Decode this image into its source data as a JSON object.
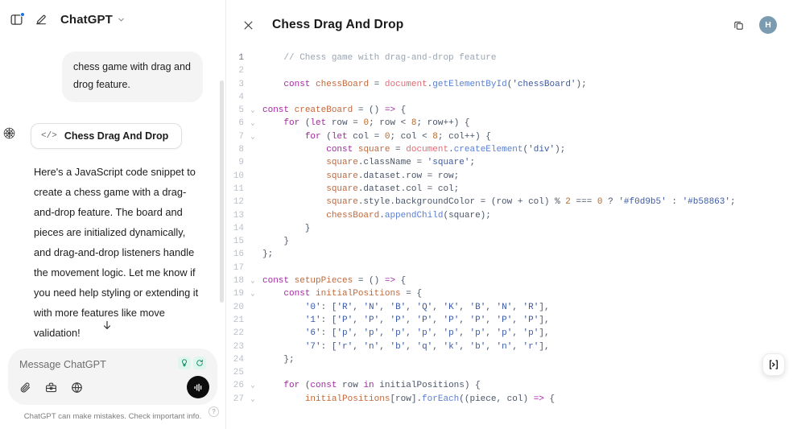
{
  "chat": {
    "topbar": {
      "sidebar_toggle_icon": "sidebar-toggle-icon",
      "new_chat_icon": "compose-icon",
      "brand": "ChatGPT",
      "brand_chevron_icon": "chevron-down-icon"
    },
    "user_message": "chess game with drag and drog feature.",
    "artifact_pill": {
      "icon": "code-brackets-icon",
      "label": "Chess Drag And Drop"
    },
    "assistant_message": "Here's a JavaScript code snippet to create a chess game with a drag-and-drop feature. The board and pieces are initialized dynamically, and drag-and-drop listeners handle the movement logic. Let me know if you need help styling or extending it with more features like move validation!",
    "actions": [
      {
        "name": "read-aloud-icon",
        "title": "Read aloud"
      },
      {
        "name": "copy-icon",
        "title": "Copy"
      },
      {
        "name": "thumbs-up-icon",
        "title": "Good response"
      },
      {
        "name": "thumbs-down-icon",
        "title": "Bad response"
      }
    ],
    "scroll_down_icon": "arrow-down-icon",
    "composer": {
      "placeholder": "Message ChatGPT",
      "value": "",
      "chips": [
        {
          "name": "lightbulb-icon"
        },
        {
          "name": "sync-icon"
        }
      ],
      "tools": [
        {
          "name": "attach-icon"
        },
        {
          "name": "toolbox-icon"
        },
        {
          "name": "globe-icon"
        }
      ],
      "voice_button_icon": "voice-waveform-icon"
    },
    "disclaimer": "ChatGPT can make mistakes. Check important info.",
    "help_label": "?"
  },
  "code_panel": {
    "close_icon": "close-icon",
    "title": "Chess Drag And Drop",
    "copy_icon": "copy-icon",
    "avatar_initial": "H",
    "run_button_icon": "run-code-icon",
    "lines": [
      {
        "n": "1",
        "fold": "",
        "tokens": [
          {
            "t": "    ",
            "c": "t-pl"
          },
          {
            "t": "// Chess game with drag-and-drop feature",
            "c": "t-com"
          }
        ]
      },
      {
        "n": "2",
        "fold": "",
        "tokens": []
      },
      {
        "n": "3",
        "fold": "",
        "tokens": [
          {
            "t": "    ",
            "c": "t-pl"
          },
          {
            "t": "const",
            "c": "t-kw"
          },
          {
            "t": " ",
            "c": "t-pl"
          },
          {
            "t": "chessBoard",
            "c": "t-var"
          },
          {
            "t": " = ",
            "c": "t-op"
          },
          {
            "t": "document",
            "c": "t-obj"
          },
          {
            "t": ".",
            "c": "t-op"
          },
          {
            "t": "getElementById",
            "c": "t-fn"
          },
          {
            "t": "(",
            "c": "t-op"
          },
          {
            "t": "'chessBoard'",
            "c": "t-str"
          },
          {
            "t": ");",
            "c": "t-op"
          }
        ]
      },
      {
        "n": "4",
        "fold": "",
        "tokens": []
      },
      {
        "n": "5",
        "fold": "v",
        "tokens": [
          {
            "t": "const",
            "c": "t-kw"
          },
          {
            "t": " ",
            "c": "t-pl"
          },
          {
            "t": "createBoard",
            "c": "t-var"
          },
          {
            "t": " = () ",
            "c": "t-op"
          },
          {
            "t": "=>",
            "c": "t-kw"
          },
          {
            "t": " {",
            "c": "t-op"
          }
        ]
      },
      {
        "n": "6",
        "fold": "v",
        "tokens": [
          {
            "t": "    ",
            "c": "t-pl"
          },
          {
            "t": "for",
            "c": "t-kw"
          },
          {
            "t": " (",
            "c": "t-op"
          },
          {
            "t": "let",
            "c": "t-kw"
          },
          {
            "t": " row = ",
            "c": "t-op"
          },
          {
            "t": "0",
            "c": "t-num"
          },
          {
            "t": "; row < ",
            "c": "t-op"
          },
          {
            "t": "8",
            "c": "t-num"
          },
          {
            "t": "; row++) {",
            "c": "t-op"
          }
        ]
      },
      {
        "n": "7",
        "fold": "v",
        "tokens": [
          {
            "t": "        ",
            "c": "t-pl"
          },
          {
            "t": "for",
            "c": "t-kw"
          },
          {
            "t": " (",
            "c": "t-op"
          },
          {
            "t": "let",
            "c": "t-kw"
          },
          {
            "t": " col = ",
            "c": "t-op"
          },
          {
            "t": "0",
            "c": "t-num"
          },
          {
            "t": "; col < ",
            "c": "t-op"
          },
          {
            "t": "8",
            "c": "t-num"
          },
          {
            "t": "; col++) {",
            "c": "t-op"
          }
        ]
      },
      {
        "n": "8",
        "fold": "",
        "tokens": [
          {
            "t": "            ",
            "c": "t-pl"
          },
          {
            "t": "const",
            "c": "t-kw"
          },
          {
            "t": " ",
            "c": "t-pl"
          },
          {
            "t": "square",
            "c": "t-var"
          },
          {
            "t": " = ",
            "c": "t-op"
          },
          {
            "t": "document",
            "c": "t-obj"
          },
          {
            "t": ".",
            "c": "t-op"
          },
          {
            "t": "createElement",
            "c": "t-fn"
          },
          {
            "t": "(",
            "c": "t-op"
          },
          {
            "t": "'div'",
            "c": "t-str"
          },
          {
            "t": ");",
            "c": "t-op"
          }
        ]
      },
      {
        "n": "9",
        "fold": "",
        "tokens": [
          {
            "t": "            ",
            "c": "t-pl"
          },
          {
            "t": "square",
            "c": "t-var"
          },
          {
            "t": ".className = ",
            "c": "t-op"
          },
          {
            "t": "'square'",
            "c": "t-str"
          },
          {
            "t": ";",
            "c": "t-op"
          }
        ]
      },
      {
        "n": "10",
        "fold": "",
        "tokens": [
          {
            "t": "            ",
            "c": "t-pl"
          },
          {
            "t": "square",
            "c": "t-var"
          },
          {
            "t": ".dataset.row = row;",
            "c": "t-op"
          }
        ]
      },
      {
        "n": "11",
        "fold": "",
        "tokens": [
          {
            "t": "            ",
            "c": "t-pl"
          },
          {
            "t": "square",
            "c": "t-var"
          },
          {
            "t": ".dataset.col = col;",
            "c": "t-op"
          }
        ]
      },
      {
        "n": "12",
        "fold": "",
        "tokens": [
          {
            "t": "            ",
            "c": "t-pl"
          },
          {
            "t": "square",
            "c": "t-var"
          },
          {
            "t": ".style.backgroundColor = (row + col) % ",
            "c": "t-op"
          },
          {
            "t": "2",
            "c": "t-num"
          },
          {
            "t": " === ",
            "c": "t-op"
          },
          {
            "t": "0",
            "c": "t-num"
          },
          {
            "t": " ? ",
            "c": "t-op"
          },
          {
            "t": "'#f0d9b5'",
            "c": "t-str"
          },
          {
            "t": " : ",
            "c": "t-op"
          },
          {
            "t": "'#b58863'",
            "c": "t-str"
          },
          {
            "t": ";",
            "c": "t-op"
          }
        ]
      },
      {
        "n": "13",
        "fold": "",
        "tokens": [
          {
            "t": "            ",
            "c": "t-pl"
          },
          {
            "t": "chessBoard",
            "c": "t-var"
          },
          {
            "t": ".",
            "c": "t-op"
          },
          {
            "t": "appendChild",
            "c": "t-fn"
          },
          {
            "t": "(square);",
            "c": "t-op"
          }
        ]
      },
      {
        "n": "14",
        "fold": "",
        "tokens": [
          {
            "t": "        }",
            "c": "t-op"
          }
        ]
      },
      {
        "n": "15",
        "fold": "",
        "tokens": [
          {
            "t": "    }",
            "c": "t-op"
          }
        ]
      },
      {
        "n": "16",
        "fold": "",
        "tokens": [
          {
            "t": "};",
            "c": "t-op"
          }
        ]
      },
      {
        "n": "17",
        "fold": "",
        "tokens": []
      },
      {
        "n": "18",
        "fold": "v",
        "tokens": [
          {
            "t": "const",
            "c": "t-kw"
          },
          {
            "t": " ",
            "c": "t-pl"
          },
          {
            "t": "setupPieces",
            "c": "t-var"
          },
          {
            "t": " = () ",
            "c": "t-op"
          },
          {
            "t": "=>",
            "c": "t-kw"
          },
          {
            "t": " {",
            "c": "t-op"
          }
        ]
      },
      {
        "n": "19",
        "fold": "v",
        "tokens": [
          {
            "t": "    ",
            "c": "t-pl"
          },
          {
            "t": "const",
            "c": "t-kw"
          },
          {
            "t": " ",
            "c": "t-pl"
          },
          {
            "t": "initialPositions",
            "c": "t-var"
          },
          {
            "t": " = {",
            "c": "t-op"
          }
        ]
      },
      {
        "n": "20",
        "fold": "",
        "tokens": [
          {
            "t": "        ",
            "c": "t-pl"
          },
          {
            "t": "'0'",
            "c": "t-str"
          },
          {
            "t": ": [",
            "c": "t-op"
          },
          {
            "t": "'R'",
            "c": "t-str"
          },
          {
            "t": ", ",
            "c": "t-op"
          },
          {
            "t": "'N'",
            "c": "t-str"
          },
          {
            "t": ", ",
            "c": "t-op"
          },
          {
            "t": "'B'",
            "c": "t-str"
          },
          {
            "t": ", ",
            "c": "t-op"
          },
          {
            "t": "'Q'",
            "c": "t-str"
          },
          {
            "t": ", ",
            "c": "t-op"
          },
          {
            "t": "'K'",
            "c": "t-str"
          },
          {
            "t": ", ",
            "c": "t-op"
          },
          {
            "t": "'B'",
            "c": "t-str"
          },
          {
            "t": ", ",
            "c": "t-op"
          },
          {
            "t": "'N'",
            "c": "t-str"
          },
          {
            "t": ", ",
            "c": "t-op"
          },
          {
            "t": "'R'",
            "c": "t-str"
          },
          {
            "t": "],",
            "c": "t-op"
          }
        ]
      },
      {
        "n": "21",
        "fold": "",
        "tokens": [
          {
            "t": "        ",
            "c": "t-pl"
          },
          {
            "t": "'1'",
            "c": "t-str"
          },
          {
            "t": ": [",
            "c": "t-op"
          },
          {
            "t": "'P'",
            "c": "t-str"
          },
          {
            "t": ", ",
            "c": "t-op"
          },
          {
            "t": "'P'",
            "c": "t-str"
          },
          {
            "t": ", ",
            "c": "t-op"
          },
          {
            "t": "'P'",
            "c": "t-str"
          },
          {
            "t": ", ",
            "c": "t-op"
          },
          {
            "t": "'P'",
            "c": "t-str"
          },
          {
            "t": ", ",
            "c": "t-op"
          },
          {
            "t": "'P'",
            "c": "t-str"
          },
          {
            "t": ", ",
            "c": "t-op"
          },
          {
            "t": "'P'",
            "c": "t-str"
          },
          {
            "t": ", ",
            "c": "t-op"
          },
          {
            "t": "'P'",
            "c": "t-str"
          },
          {
            "t": ", ",
            "c": "t-op"
          },
          {
            "t": "'P'",
            "c": "t-str"
          },
          {
            "t": "],",
            "c": "t-op"
          }
        ]
      },
      {
        "n": "22",
        "fold": "",
        "tokens": [
          {
            "t": "        ",
            "c": "t-pl"
          },
          {
            "t": "'6'",
            "c": "t-str"
          },
          {
            "t": ": [",
            "c": "t-op"
          },
          {
            "t": "'p'",
            "c": "t-str"
          },
          {
            "t": ", ",
            "c": "t-op"
          },
          {
            "t": "'p'",
            "c": "t-str"
          },
          {
            "t": ", ",
            "c": "t-op"
          },
          {
            "t": "'p'",
            "c": "t-str"
          },
          {
            "t": ", ",
            "c": "t-op"
          },
          {
            "t": "'p'",
            "c": "t-str"
          },
          {
            "t": ", ",
            "c": "t-op"
          },
          {
            "t": "'p'",
            "c": "t-str"
          },
          {
            "t": ", ",
            "c": "t-op"
          },
          {
            "t": "'p'",
            "c": "t-str"
          },
          {
            "t": ", ",
            "c": "t-op"
          },
          {
            "t": "'p'",
            "c": "t-str"
          },
          {
            "t": ", ",
            "c": "t-op"
          },
          {
            "t": "'p'",
            "c": "t-str"
          },
          {
            "t": "],",
            "c": "t-op"
          }
        ]
      },
      {
        "n": "23",
        "fold": "",
        "tokens": [
          {
            "t": "        ",
            "c": "t-pl"
          },
          {
            "t": "'7'",
            "c": "t-str"
          },
          {
            "t": ": [",
            "c": "t-op"
          },
          {
            "t": "'r'",
            "c": "t-str"
          },
          {
            "t": ", ",
            "c": "t-op"
          },
          {
            "t": "'n'",
            "c": "t-str"
          },
          {
            "t": ", ",
            "c": "t-op"
          },
          {
            "t": "'b'",
            "c": "t-str"
          },
          {
            "t": ", ",
            "c": "t-op"
          },
          {
            "t": "'q'",
            "c": "t-str"
          },
          {
            "t": ", ",
            "c": "t-op"
          },
          {
            "t": "'k'",
            "c": "t-str"
          },
          {
            "t": ", ",
            "c": "t-op"
          },
          {
            "t": "'b'",
            "c": "t-str"
          },
          {
            "t": ", ",
            "c": "t-op"
          },
          {
            "t": "'n'",
            "c": "t-str"
          },
          {
            "t": ", ",
            "c": "t-op"
          },
          {
            "t": "'r'",
            "c": "t-str"
          },
          {
            "t": "],",
            "c": "t-op"
          }
        ]
      },
      {
        "n": "24",
        "fold": "",
        "tokens": [
          {
            "t": "    };",
            "c": "t-op"
          }
        ]
      },
      {
        "n": "25",
        "fold": "",
        "tokens": []
      },
      {
        "n": "26",
        "fold": "v",
        "tokens": [
          {
            "t": "    ",
            "c": "t-pl"
          },
          {
            "t": "for",
            "c": "t-kw"
          },
          {
            "t": " (",
            "c": "t-op"
          },
          {
            "t": "const",
            "c": "t-kw"
          },
          {
            "t": " row ",
            "c": "t-op"
          },
          {
            "t": "in",
            "c": "t-kw"
          },
          {
            "t": " initialPositions) {",
            "c": "t-op"
          }
        ]
      },
      {
        "n": "27",
        "fold": "v",
        "tokens": [
          {
            "t": "        ",
            "c": "t-pl"
          },
          {
            "t": "initialPositions",
            "c": "t-var"
          },
          {
            "t": "[row].",
            "c": "t-op"
          },
          {
            "t": "forEach",
            "c": "t-fn"
          },
          {
            "t": "((piece, col) ",
            "c": "t-op"
          },
          {
            "t": "=>",
            "c": "t-kw"
          },
          {
            "t": " {",
            "c": "t-op"
          }
        ]
      }
    ]
  }
}
